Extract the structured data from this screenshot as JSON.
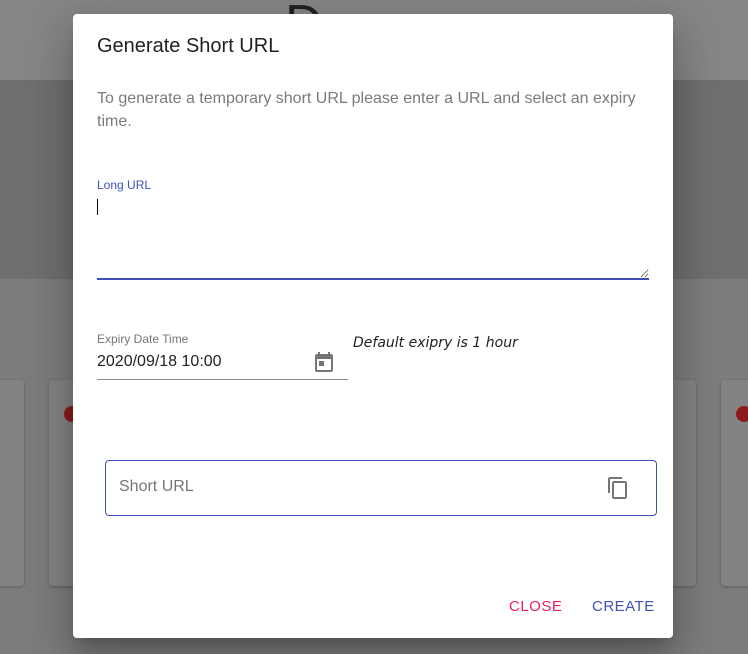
{
  "background": {
    "header_text": "Dashboard"
  },
  "dialog": {
    "title": "Generate Short URL",
    "description": "To generate a temporary short URL please enter a URL and select an expiry time.",
    "long_url": {
      "label": "Long URL",
      "value": ""
    },
    "expiry": {
      "label": "Expiry Date Time",
      "value": "2020/09/18 10:00",
      "note": "Default exipry is 1 hour",
      "icon": "calendar-icon"
    },
    "short_url": {
      "placeholder": "Short URL",
      "icon": "copy-icon"
    },
    "actions": {
      "close_label": "CLOSE",
      "create_label": "CREATE"
    },
    "colors": {
      "primary": "#3f51b5",
      "accent": "#e91e63"
    }
  }
}
